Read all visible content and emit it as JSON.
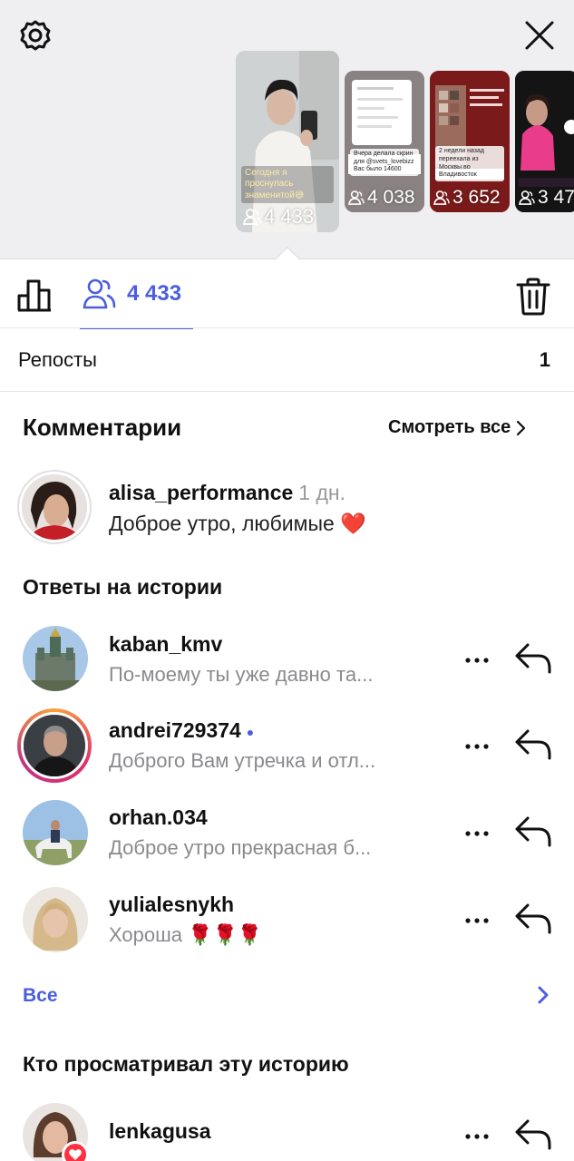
{
  "thumbnails": [
    {
      "count": "4 433",
      "caption": "Сегодня я проснулась знаменитой😅"
    },
    {
      "count": "4 038",
      "caption": "Вчера делала скрин для @svets_lovebizz  Вас было 14600"
    },
    {
      "count": "3 652",
      "caption": "2 недели назад переехала из Москвы во Владивосток"
    },
    {
      "count": "3 47",
      "caption": ""
    }
  ],
  "tabs": {
    "viewers_count": "4 433"
  },
  "reposts": {
    "label": "Репосты",
    "value": "1"
  },
  "comments": {
    "title": "Комментарии",
    "see_all": "Смотреть все",
    "items": [
      {
        "username": "alisa_performance",
        "time": "1 дн.",
        "text": "Доброе утро, любимые ❤️"
      }
    ]
  },
  "replies": {
    "title": "Ответы на истории",
    "items": [
      {
        "username": "kaban_kmv",
        "text": "По-моему ты уже давно та...",
        "has_dot": false
      },
      {
        "username": "andrei729374",
        "text": "Доброго Вам утречка и отл...",
        "has_dot": true
      },
      {
        "username": "orhan.034",
        "text": "Доброе утро прекрасная б...",
        "has_dot": false
      },
      {
        "username": "yulialesnykh",
        "text": "Хороша 🌹🌹🌹",
        "has_dot": false
      }
    ],
    "all_label": "Все"
  },
  "viewers": {
    "title": "Кто просматривал эту историю",
    "items": [
      {
        "username": "lenkagusa"
      }
    ]
  },
  "colors": {
    "accent": "#4a5ee0",
    "muted": "#8a8a8e",
    "heart": "#ff3040"
  }
}
